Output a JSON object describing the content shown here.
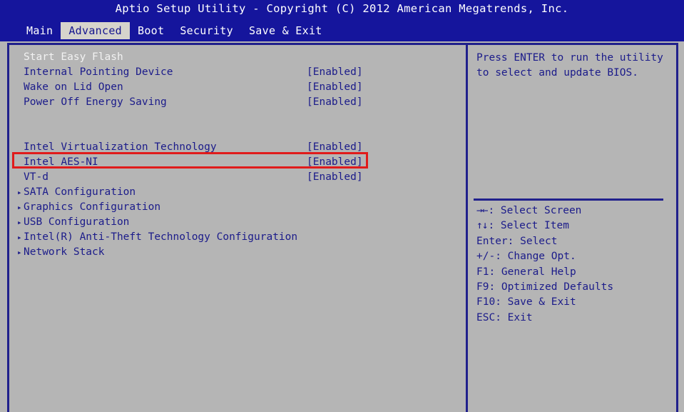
{
  "header": {
    "title": "Aptio Setup Utility - Copyright (C) 2012 American Megatrends, Inc.",
    "tabs": [
      {
        "label": "Main",
        "active": false
      },
      {
        "label": "Advanced",
        "active": true
      },
      {
        "label": "Boot",
        "active": false
      },
      {
        "label": "Security",
        "active": false
      },
      {
        "label": "Save & Exit",
        "active": false
      }
    ]
  },
  "settings": [
    {
      "label": "Start Easy Flash",
      "value": "",
      "submenu": false,
      "selected": true
    },
    {
      "label": "Internal Pointing Device",
      "value": "[Enabled]",
      "submenu": false,
      "selected": false
    },
    {
      "label": "Wake on Lid Open",
      "value": "[Enabled]",
      "submenu": false,
      "selected": false
    },
    {
      "label": "Power Off Energy Saving",
      "value": "[Enabled]",
      "submenu": false,
      "selected": false
    },
    {
      "label": "",
      "value": "",
      "spacer": true
    },
    {
      "label": "",
      "value": "",
      "spacer": true
    },
    {
      "label": "Intel Virtualization Technology",
      "value": "[Enabled]",
      "submenu": false,
      "selected": false
    },
    {
      "label": "Intel AES-NI",
      "value": "[Enabled]",
      "submenu": false,
      "selected": false,
      "highlighted": true
    },
    {
      "label": "VT-d",
      "value": "[Enabled]",
      "submenu": false,
      "selected": false
    },
    {
      "label": "SATA Configuration",
      "value": "",
      "submenu": true,
      "selected": false
    },
    {
      "label": "Graphics Configuration",
      "value": "",
      "submenu": true,
      "selected": false
    },
    {
      "label": "USB Configuration",
      "value": "",
      "submenu": true,
      "selected": false
    },
    {
      "label": "Intel(R) Anti-Theft Technology Configuration",
      "value": "",
      "submenu": true,
      "selected": false
    },
    {
      "label": "Network Stack",
      "value": "",
      "submenu": true,
      "selected": false
    }
  ],
  "help": {
    "line1": "Press ENTER to run the utility",
    "line2": "to select and update BIOS."
  },
  "keys": [
    {
      "glyph": "→←",
      "text": ": Select Screen"
    },
    {
      "glyph": "↑↓",
      "text": ": Select Item"
    },
    {
      "glyph": "",
      "text": "Enter: Select"
    },
    {
      "glyph": "",
      "text": "+/-: Change Opt."
    },
    {
      "glyph": "",
      "text": "F1: General Help"
    },
    {
      "glyph": "",
      "text": "F9: Optimized Defaults"
    },
    {
      "glyph": "",
      "text": "F10: Save & Exit"
    },
    {
      "glyph": "",
      "text": "ESC: Exit"
    }
  ],
  "icons": {
    "submenu_arrow": "▸"
  },
  "colors": {
    "header_blue": "#15159c",
    "panel_gray": "#b5b5b5",
    "text_blue": "#1b1b8a",
    "border_blue": "#20208c",
    "annotation_red": "#e01b1b",
    "selected_text": "#f2f2f2",
    "active_tab_bg": "#d6d4cc"
  }
}
